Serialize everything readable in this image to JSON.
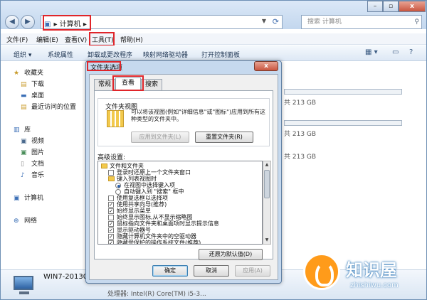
{
  "explorer": {
    "address": {
      "crumbs": "计算机",
      "arrow": "▸"
    },
    "search_placeholder": "搜索 计算机",
    "menu": [
      "文件(F)",
      "编辑(E)",
      "查看(V)",
      "工具(T)",
      "帮助(H)"
    ],
    "toolbar": [
      "组织 ▾",
      "系统属性",
      "卸载或更改程序",
      "映射网络驱动器",
      "打开控制面板"
    ],
    "sidebar": {
      "favorites": "收藏夹",
      "fav_items": [
        "下载",
        "桌面",
        "最近访问的位置"
      ],
      "library": "库",
      "lib_items": [
        "视频",
        "图片",
        "文档",
        "音乐"
      ],
      "computer": "计算机",
      "network": "网络"
    },
    "drives": [
      {
        "free": "共 213 GB"
      },
      {
        "free": "共 213 GB"
      },
      {
        "free": "共 213 GB"
      }
    ],
    "status": {
      "name": "WIN7-20130",
      "cpu": "处理器: Intel(R) Core(TM) i5-3..."
    }
  },
  "dialog": {
    "title": "文件夹选项",
    "tabs": [
      "常规",
      "查看",
      "搜索"
    ],
    "folder_views": {
      "label": "文件夹视图",
      "description": "可以将该视图(例如\"详细信息\"或\"图标\")应用到所有这种类型的文件夹中。",
      "apply_btn": "应用到文件夹(L)",
      "reset_btn": "重置文件夹(R)"
    },
    "advanced_label": "高级设置:",
    "tree": [
      {
        "type": "folder",
        "text": "文件和文件夹",
        "indent": 0
      },
      {
        "type": "check",
        "text": "登录时还原上一个文件夹窗口",
        "checked": false,
        "indent": 1
      },
      {
        "type": "folder",
        "text": "键入列表视图时",
        "indent": 1
      },
      {
        "type": "radio",
        "text": "在视图中选择键入项",
        "checked": true,
        "indent": 2
      },
      {
        "type": "radio",
        "text": "自动键入到 \"搜索\" 框中",
        "checked": false,
        "indent": 2
      },
      {
        "type": "check",
        "text": "使用复选框以选择项",
        "checked": false,
        "indent": 1
      },
      {
        "type": "check",
        "text": "使用共享向导(推荐)",
        "checked": true,
        "indent": 1
      },
      {
        "type": "check",
        "text": "始终显示菜单",
        "checked": true,
        "indent": 1
      },
      {
        "type": "check",
        "text": "始终显示图标,从不显示缩略图",
        "checked": false,
        "indent": 1
      },
      {
        "type": "check",
        "text": "鼠标指向文件夹和桌面项时显示提示信息",
        "checked": true,
        "indent": 1
      },
      {
        "type": "check",
        "text": "显示驱动器号",
        "checked": true,
        "indent": 1
      },
      {
        "type": "check",
        "text": "隐藏计算机文件夹中的空驱动器",
        "checked": true,
        "indent": 1
      },
      {
        "type": "check",
        "text": "隐藏受保护的操作系统文件(推荐)",
        "checked": true,
        "indent": 1
      }
    ],
    "restore_btn": "还原为默认值(D)",
    "ok": "确定",
    "cancel": "取消",
    "apply": "应用(A)",
    "close": "x"
  },
  "watermark": {
    "title": "知识屋",
    "url": "zhishiwu.com"
  }
}
